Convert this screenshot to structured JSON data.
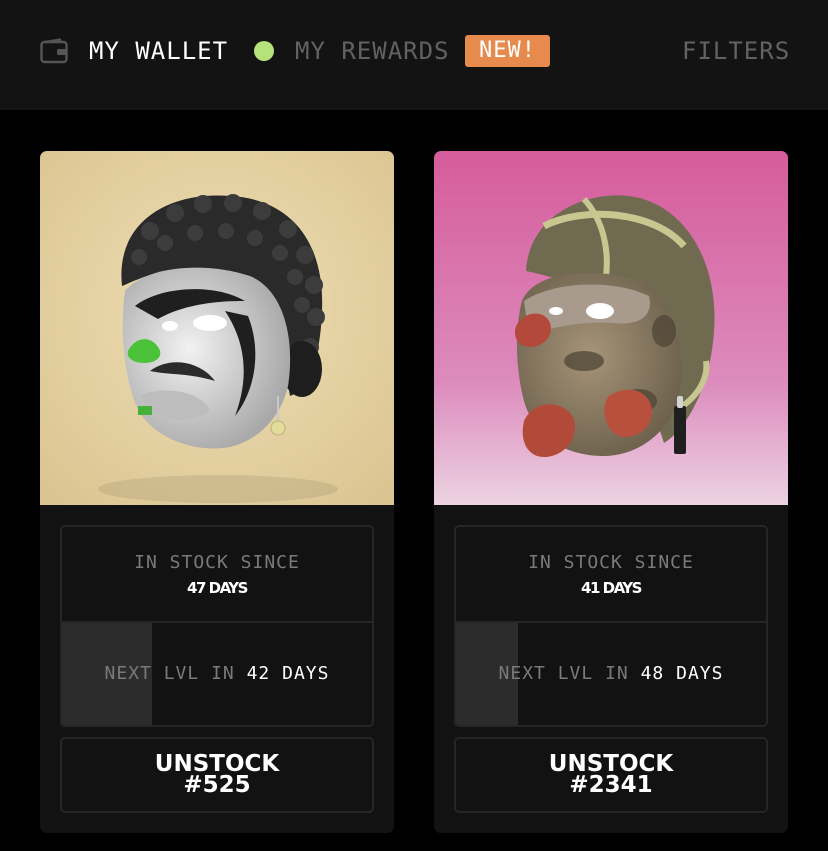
{
  "header": {
    "tabs": {
      "wallet": "MY WALLET",
      "rewards": "MY REWARDS"
    },
    "new_badge": "NEW!",
    "filters": "FILTERS",
    "icons": {
      "wallet": "wallet-icon",
      "status": "status-dot"
    }
  },
  "colors": {
    "header_bg": "#131313",
    "page_bg": "#000000",
    "card_bg": "#121212",
    "status_dot": "#b5e27a",
    "new_badge": "#e68a4e",
    "muted_text": "#626262"
  },
  "cards": [
    {
      "image": "white-mask-with-curly-black-hair",
      "background": "beige",
      "stock_label": "IN STOCK SINCE",
      "stock_days": "47 DAYS",
      "level_prefix": "NEXT LVL IN",
      "level_days": "42 DAYS",
      "level_progress": 0.29,
      "action_line1": "UNSTOCK",
      "action_line2": "#525"
    },
    {
      "image": "camo-mask-with-red-lips",
      "background": "pink",
      "stock_label": "IN STOCK SINCE",
      "stock_days": "41 DAYS",
      "level_prefix": "NEXT LVL IN",
      "level_days": "48 DAYS",
      "level_progress": 0.2,
      "action_line1": "UNSTOCK",
      "action_line2": "#2341"
    }
  ]
}
